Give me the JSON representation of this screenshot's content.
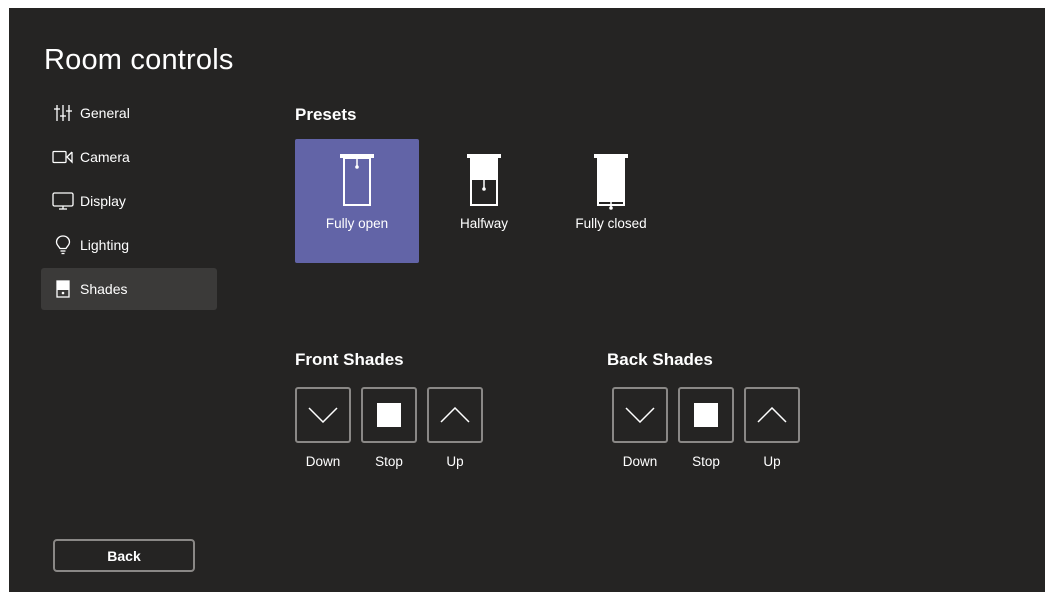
{
  "title": "Room controls",
  "nav": {
    "items": [
      {
        "label": "General",
        "icon": "sliders-icon"
      },
      {
        "label": "Camera",
        "icon": "camera-icon"
      },
      {
        "label": "Display",
        "icon": "monitor-icon"
      },
      {
        "label": "Lighting",
        "icon": "lightbulb-icon"
      },
      {
        "label": "Shades",
        "icon": "shades-icon"
      }
    ],
    "selected": "Shades"
  },
  "presets": {
    "title": "Presets",
    "items": [
      {
        "label": "Fully open",
        "icon": "shade-open-icon",
        "selected": true
      },
      {
        "label": "Halfway",
        "icon": "shade-half-icon",
        "selected": false
      },
      {
        "label": "Fully closed",
        "icon": "shade-closed-icon",
        "selected": false
      }
    ]
  },
  "front_shades": {
    "title": "Front Shades",
    "down_label": "Down",
    "stop_label": "Stop",
    "up_label": "Up"
  },
  "back_shades": {
    "title": "Back Shades",
    "down_label": "Down",
    "stop_label": "Stop",
    "up_label": "Up"
  },
  "back_button": "Back",
  "colors": {
    "background": "#252423",
    "accent": "#6264a7",
    "selected_nav": "#3b3a39",
    "border": "#8a8886"
  }
}
